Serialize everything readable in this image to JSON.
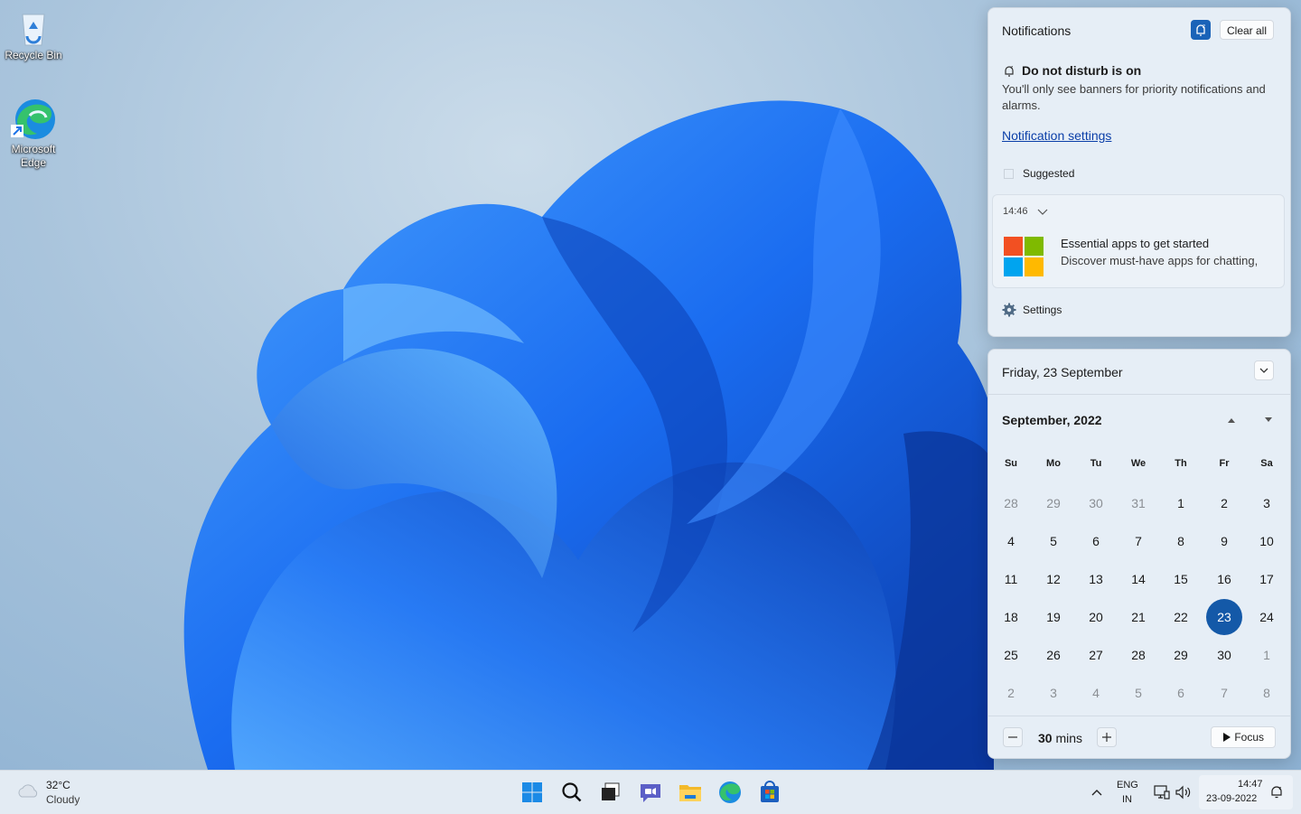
{
  "desktop": {
    "icons": [
      {
        "label": "Recycle Bin",
        "icon": "recycle-bin-icon"
      },
      {
        "label": "Microsoft Edge",
        "icon": "edge-icon"
      }
    ]
  },
  "notifications": {
    "title": "Notifications",
    "clear_all": "Clear all",
    "dnd_title": "Do not disturb is on",
    "dnd_desc": "You'll only see banners for priority notifications and alarms.",
    "settings_link": "Notification settings",
    "group_label": "Suggested",
    "toast": {
      "time": "14:46",
      "title": "Essential apps to get started",
      "body": "Discover must-have apps for chatting,"
    },
    "footer_label": "Settings"
  },
  "calendar": {
    "date_header": "Friday, 23 September",
    "month_label": "September, 2022",
    "weekdays": [
      "Su",
      "Mo",
      "Tu",
      "We",
      "Th",
      "Fr",
      "Sa"
    ],
    "weeks": [
      [
        "28",
        "29",
        "30",
        "31",
        "1",
        "2",
        "3"
      ],
      [
        "4",
        "5",
        "6",
        "7",
        "8",
        "9",
        "10"
      ],
      [
        "11",
        "12",
        "13",
        "14",
        "15",
        "16",
        "17"
      ],
      [
        "18",
        "19",
        "20",
        "21",
        "22",
        "23",
        "24"
      ],
      [
        "25",
        "26",
        "27",
        "28",
        "29",
        "30",
        "1"
      ],
      [
        "2",
        "3",
        "4",
        "5",
        "6",
        "7",
        "8"
      ]
    ],
    "selected_day": "23",
    "focus": {
      "minutes": "30",
      "unit": "mins",
      "button": "Focus"
    }
  },
  "taskbar": {
    "weather": {
      "temp": "32°C",
      "condition": "Cloudy"
    },
    "apps": [
      "start-icon",
      "search-icon",
      "task-view-icon",
      "chat-icon",
      "file-explorer-icon",
      "edge-icon",
      "store-icon"
    ],
    "lang_line1": "ENG",
    "lang_line2": "IN",
    "time": "14:47",
    "date": "23-09-2022"
  },
  "colors": {
    "accent": "#1459a8",
    "panel_bg": "#e6eef6",
    "taskbar_bg": "#e3ebf3",
    "wallpaper_blue": "#1f6fe8"
  }
}
